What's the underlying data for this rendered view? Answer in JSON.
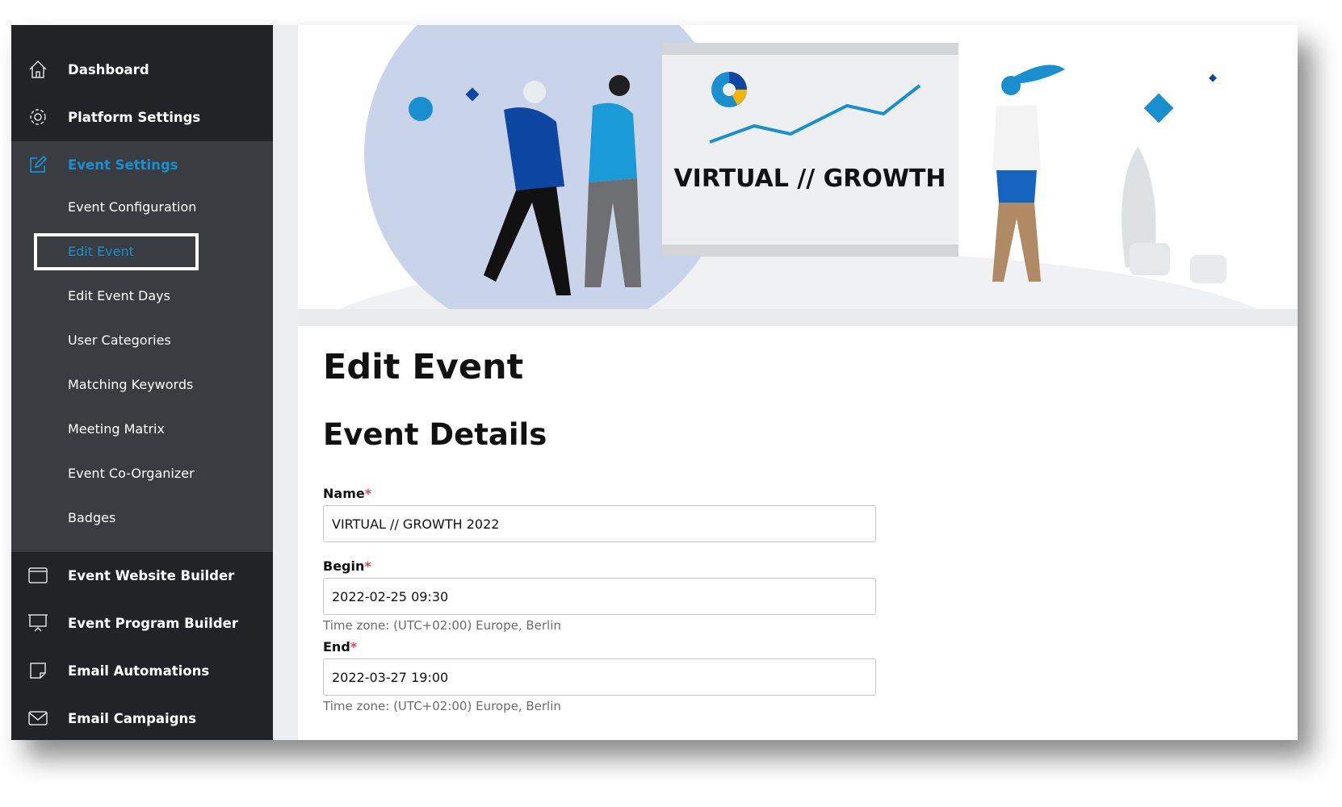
{
  "colors": {
    "accent": "#1a8fd0",
    "sidebar_bg": "#212326",
    "sidebar_sub_bg": "#393c40",
    "required": "#e0474c"
  },
  "sidebar": {
    "top_items": [
      {
        "label": "Dashboard",
        "icon": "home-icon"
      },
      {
        "label": "Platform Settings",
        "icon": "gear-icon"
      }
    ],
    "section": {
      "label": "Event Settings",
      "icon": "edit-icon",
      "items": [
        "Event Configuration",
        "Edit Event",
        "Edit Event Days",
        "User Categories",
        "Matching Keywords",
        "Meeting Matrix",
        "Event Co-Organizer",
        "Badges"
      ],
      "active_item": "Edit Event"
    },
    "bottom_items": [
      {
        "label": "Event Website Builder",
        "icon": "browser-window-icon"
      },
      {
        "label": "Event Program Builder",
        "icon": "presentation-board-icon"
      },
      {
        "label": "Email Automations",
        "icon": "note-icon"
      },
      {
        "label": "Email Campaigns",
        "icon": "envelope-icon"
      }
    ]
  },
  "banner": {
    "logo_text": "VIRTUAL // GROWTH"
  },
  "main": {
    "title": "Edit Event",
    "section_title": "Event Details",
    "fields": {
      "name": {
        "label": "Name",
        "required_mark": "*",
        "value": "VIRTUAL // GROWTH 2022"
      },
      "begin": {
        "label": "Begin",
        "required_mark": "*",
        "value": "2022-02-25 09:30",
        "hint": "Time zone: (UTC+02:00) Europe, Berlin"
      },
      "end": {
        "label": "End",
        "required_mark": "*",
        "value": "2022-03-27 19:00",
        "hint": "Time zone: (UTC+02:00) Europe, Berlin"
      }
    }
  }
}
